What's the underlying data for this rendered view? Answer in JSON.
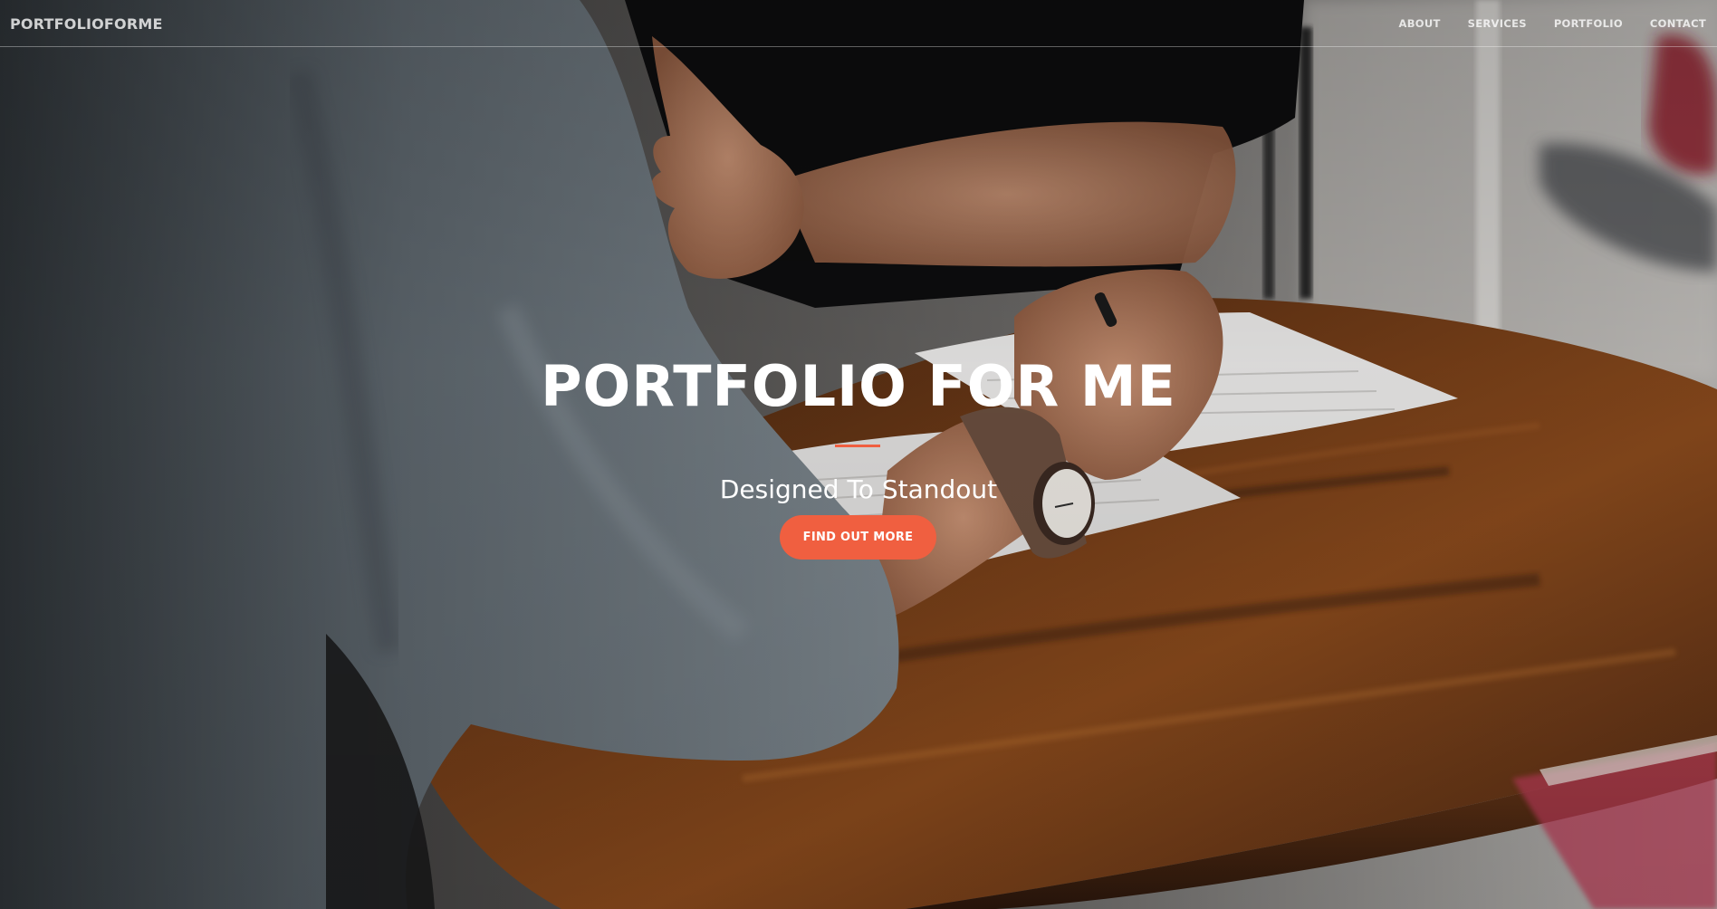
{
  "navbar": {
    "brand": "PORTFOLIOFORME",
    "links": [
      "ABOUT",
      "SERVICES",
      "PORTFOLIO",
      "CONTACT"
    ]
  },
  "hero": {
    "title": "PORTFOLIO FOR ME",
    "subtitle": "Designed To Standout",
    "cta_label": "FIND OUT MORE",
    "background_image": "photo of two people at a wooden table with papers, one holding a pen and wearing a wristwatch"
  },
  "colors": {
    "accent": "#f05f40",
    "nav_text": "#c8c8c8",
    "hero_text": "#ffffff"
  }
}
